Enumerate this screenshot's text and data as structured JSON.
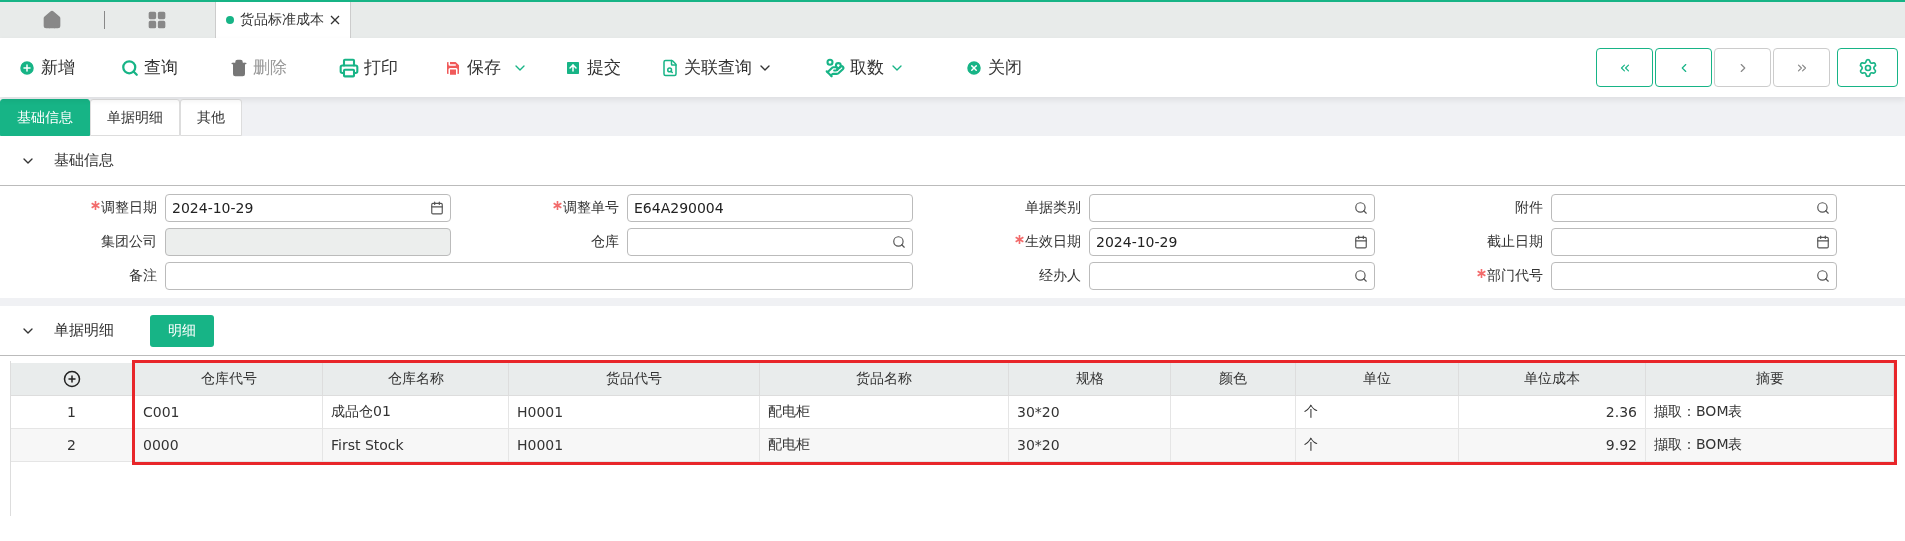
{
  "tabs": [
    {
      "label": "货品标准成本",
      "selected": true
    }
  ],
  "toolbar": [
    {
      "label": "新增",
      "disabled": false,
      "has_menu": false
    },
    {
      "label": "查询",
      "disabled": false,
      "has_menu": false
    },
    {
      "label": "删除",
      "disabled": true,
      "has_menu": false
    },
    {
      "label": "打印",
      "disabled": false,
      "has_menu": false
    },
    {
      "label": "保存",
      "disabled": false,
      "has_menu": true
    },
    {
      "label": "提交",
      "disabled": false,
      "has_menu": false
    },
    {
      "label": "关联查询",
      "disabled": false,
      "has_menu": true
    },
    {
      "label": "取数",
      "disabled": false,
      "has_menu": true
    },
    {
      "label": "关闭",
      "disabled": false,
      "has_menu": false
    }
  ],
  "nav_buttons": [
    {
      "disabled": false
    },
    {
      "disabled": false
    },
    {
      "disabled": true
    },
    {
      "disabled": true
    }
  ],
  "sub_tabs": [
    {
      "label": "基础信息",
      "selected": true
    },
    {
      "label": "单据明细",
      "selected": false
    },
    {
      "label": "其他",
      "selected": false
    }
  ],
  "basic_section": {
    "title": "基础信息",
    "expanded": true,
    "fields": [
      {
        "label": "调整日期",
        "required": true,
        "kind": "date",
        "value": "2024-10-29",
        "disabled": false
      },
      {
        "label": "调整单号",
        "required": true,
        "kind": "text",
        "value": "E64A290004",
        "disabled": false
      },
      {
        "label": "单据类别",
        "required": false,
        "kind": "lookup",
        "disabled": false
      },
      {
        "label": "附件",
        "required": false,
        "kind": "lookup",
        "disabled": false
      },
      {
        "label": "集团公司",
        "required": false,
        "kind": "text",
        "disabled": true
      },
      {
        "label": "仓库",
        "required": false,
        "kind": "lookup",
        "disabled": false
      },
      {
        "label": "生效日期",
        "required": true,
        "kind": "date",
        "value": "2024-10-29",
        "disabled": false
      },
      {
        "label": "截止日期",
        "required": false,
        "kind": "date",
        "disabled": false
      },
      {
        "label": "备注",
        "required": false,
        "kind": "wide",
        "disabled": false
      },
      {
        "label": "经办人",
        "required": false,
        "kind": "lookup",
        "disabled": false
      },
      {
        "label": "部门代号",
        "required": true,
        "kind": "lookup",
        "disabled": false
      }
    ]
  },
  "detail_section": {
    "title": "单据明细",
    "expanded": true,
    "button": "明细"
  },
  "table": {
    "highlighted": true,
    "columns": [
      "仓库代号",
      "仓库名称",
      "货品代号",
      "货品名称",
      "规格",
      "颜色",
      "单位",
      "单位成本",
      "摘要"
    ],
    "rows": [
      {
        "number": "1",
        "cells": [
          "C001",
          "成品仓01",
          "H0001",
          "配电柜",
          "30*20",
          "",
          "个",
          "2.36",
          "擷取：BOM表"
        ]
      },
      {
        "number": "2",
        "cells": [
          "0000",
          "First Stock",
          "H0001",
          "配电柜",
          "30*20",
          "",
          "个",
          "9.92",
          "擷取：BOM表"
        ]
      }
    ]
  }
}
